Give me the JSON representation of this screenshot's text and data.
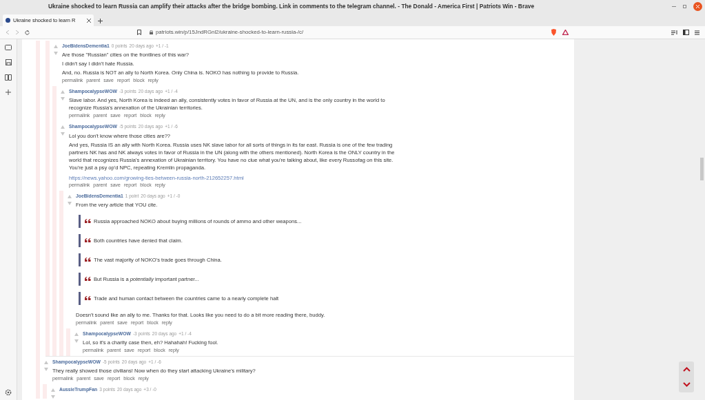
{
  "window": {
    "title": "Ukraine shocked to learn Russia can amplify their attacks after the bridge bombing. Link in comments to the telegram channel. - The Donald - America First | Patriots Win - Brave"
  },
  "tabs": [
    {
      "label": "Ukraine shocked to learn R",
      "selected": true
    }
  ],
  "address_bar": {
    "url": "patriots.win/p/15JndRGnl2/ukraine-shocked-to-learn-russia-/c/"
  },
  "comments": [
    {
      "continued": true,
      "author": "JoeBidensDementia1",
      "points": "0 points",
      "time": "20 days ago",
      "votes": "+1 / -1",
      "blocks": [
        {
          "kind": "p",
          "text": "Are those \"Russian\" cities on the frontlines of this war?"
        },
        {
          "kind": "p",
          "text": "I didn't say I didn't hate Russia."
        },
        {
          "kind": "p",
          "text": "And, no. Russia is NOT an ally to North Korea. Only China is. NOKO has nothing to provide to Russia."
        }
      ],
      "actions": [
        "permalink",
        "parent",
        "save",
        "report",
        "block",
        "reply"
      ],
      "children": [
        {
          "author": "ShampocalypseWOW",
          "points": "-3 points",
          "time": "20 days ago",
          "votes": "+1 / -4",
          "blocks": [
            {
              "kind": "p",
              "text": "Slave labor. And yes, North Korea is indeed an ally, consistently votes in favor of Russia at the UN, and is the only country in the world to recognize Russia's annexation of the Ukrainian territories."
            }
          ],
          "actions": [
            "permalink",
            "parent",
            "save",
            "report",
            "block",
            "reply"
          ]
        },
        {
          "author": "ShampocalypseWOW",
          "points": "-5 points",
          "time": "20 days ago",
          "votes": "+1 / -6",
          "blocks": [
            {
              "kind": "p",
              "text": "Lol you don't know where those cities are??"
            },
            {
              "kind": "p",
              "text": "And yes, Russia IS an ally with North Korea. Russia uses NK slave labor for all sorts of things in its far east. Russia is one of the few trading partners NK has and NK always votes in favor of Russia in the UN (along with the others mentioned). North Korea is the ONLY country in the world that recognizes Russia's annexation of Ukrainian territory. You have no clue what you're talking about, like every Russofag on this site. You're just a psy op'd NPC, repeating Kremlin propaganda."
            },
            {
              "kind": "link",
              "text": "https://news.yahoo.com/growing-ties-between-russia-north-212652257.html"
            }
          ],
          "actions": [
            "permalink",
            "parent",
            "save",
            "report",
            "block",
            "reply"
          ],
          "children": [
            {
              "author": "JoeBidensDementia1",
              "points": "1 point",
              "time": "20 days ago",
              "votes": "+1 / -0",
              "blocks": [
                {
                  "kind": "p",
                  "text": "From the very article that YOU cite."
                },
                {
                  "kind": "quote",
                  "text": "Russia approached NOKO about buying millions of rounds of ammo and other weapons..."
                },
                {
                  "kind": "quote",
                  "text": "Both countries have denied that claim."
                },
                {
                  "kind": "quote",
                  "text": "The vast majority of NOKO's trade goes through China."
                },
                {
                  "kind": "quote",
                  "text": "But Russia is a *potentially* important partner..."
                },
                {
                  "kind": "quote",
                  "text": "Trade and human contact between the countries came to a nearly complete halt"
                },
                {
                  "kind": "p",
                  "text": "Doesn't sound like an ally to me. Thanks for that. Looks like you need to do a bit more reading there, buddy."
                }
              ],
              "actions": [
                "permalink",
                "parent",
                "save",
                "report",
                "block",
                "reply"
              ],
              "children": [
                {
                  "author": "ShampocalypseWOW",
                  "points": "-3 points",
                  "time": "20 days ago",
                  "votes": "+1 / -4",
                  "blocks": [
                    {
                      "kind": "p",
                      "text": "Lol, so it's a charity case then, eh? Hahahah! Fucking fool."
                    }
                  ],
                  "actions": [
                    "permalink",
                    "parent",
                    "save",
                    "report",
                    "block",
                    "reply"
                  ]
                }
              ]
            }
          ]
        }
      ]
    },
    {
      "continued": false,
      "author": "ShampocalypseWOW",
      "points": "-5 points",
      "time": "20 days ago",
      "votes": "+1 / -6",
      "blocks": [
        {
          "kind": "p",
          "text": "They really showed those civilians! Now when do they start attacking Ukraine's military?"
        }
      ],
      "actions": [
        "permalink",
        "parent",
        "save",
        "report",
        "block",
        "reply"
      ],
      "children": [
        {
          "author": "AussieTrumpFan",
          "points": "3 points",
          "time": "20 days ago",
          "votes": "+3 / -0"
        }
      ]
    }
  ]
}
